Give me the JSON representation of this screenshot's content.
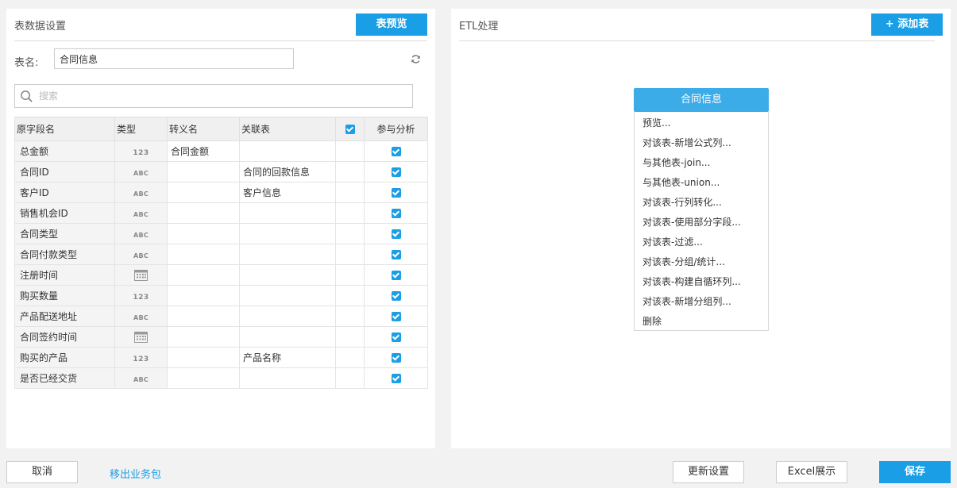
{
  "left_panel": {
    "title": "表数据设置",
    "preview_button": "表预览",
    "table_name_label": "表名:",
    "table_name_value": "合同信息",
    "search_placeholder": "搜索",
    "columns": {
      "field_name": "原字段名",
      "type": "类型",
      "alias": "转义名",
      "related_table": "关联表",
      "participate": "参与分析"
    },
    "rows": [
      {
        "name": "总金额",
        "type": "123",
        "alias": "合同金额",
        "related": "",
        "checked": true
      },
      {
        "name": "合同ID",
        "type": "ABC",
        "alias": "",
        "related": "合同的回款信息",
        "checked": true
      },
      {
        "name": "客户ID",
        "type": "ABC",
        "alias": "",
        "related": "客户信息",
        "checked": true
      },
      {
        "name": "销售机会ID",
        "type": "ABC",
        "alias": "",
        "related": "",
        "checked": true
      },
      {
        "name": "合同类型",
        "type": "ABC",
        "alias": "",
        "related": "",
        "checked": true
      },
      {
        "name": "合同付款类型",
        "type": "ABC",
        "alias": "",
        "related": "",
        "checked": true
      },
      {
        "name": "注册时间",
        "type": "date",
        "alias": "",
        "related": "",
        "checked": true
      },
      {
        "name": "购买数量",
        "type": "123",
        "alias": "",
        "related": "",
        "checked": true
      },
      {
        "name": "产品配送地址",
        "type": "ABC",
        "alias": "",
        "related": "",
        "checked": true
      },
      {
        "name": "合同签约时间",
        "type": "date",
        "alias": "",
        "related": "",
        "checked": true
      },
      {
        "name": "购买的产品",
        "type": "123",
        "alias": "",
        "related": "产品名称",
        "checked": true
      },
      {
        "name": "是否已经交货",
        "type": "ABC",
        "alias": "",
        "related": "",
        "checked": true
      }
    ]
  },
  "right_panel": {
    "title": "ETL处理",
    "add_table_button": "+ 添加表",
    "node_label": "合同信息",
    "menu_items": [
      "预览...",
      "对该表-新增公式列...",
      "与其他表-join...",
      "与其他表-union...",
      "对该表-行列转化...",
      "对该表-使用部分字段...",
      "对该表-过滤...",
      "对该表-分组/统计...",
      "对该表-构建自循环列...",
      "对该表-新增分组列...",
      "删除"
    ]
  },
  "footer": {
    "cancel": "取消",
    "remove_link": "移出业务包",
    "update_settings": "更新设置",
    "excel_display": "Excel展示",
    "save": "保存"
  },
  "colors": {
    "accent": "#1a9ee6",
    "node": "#3cace9"
  }
}
